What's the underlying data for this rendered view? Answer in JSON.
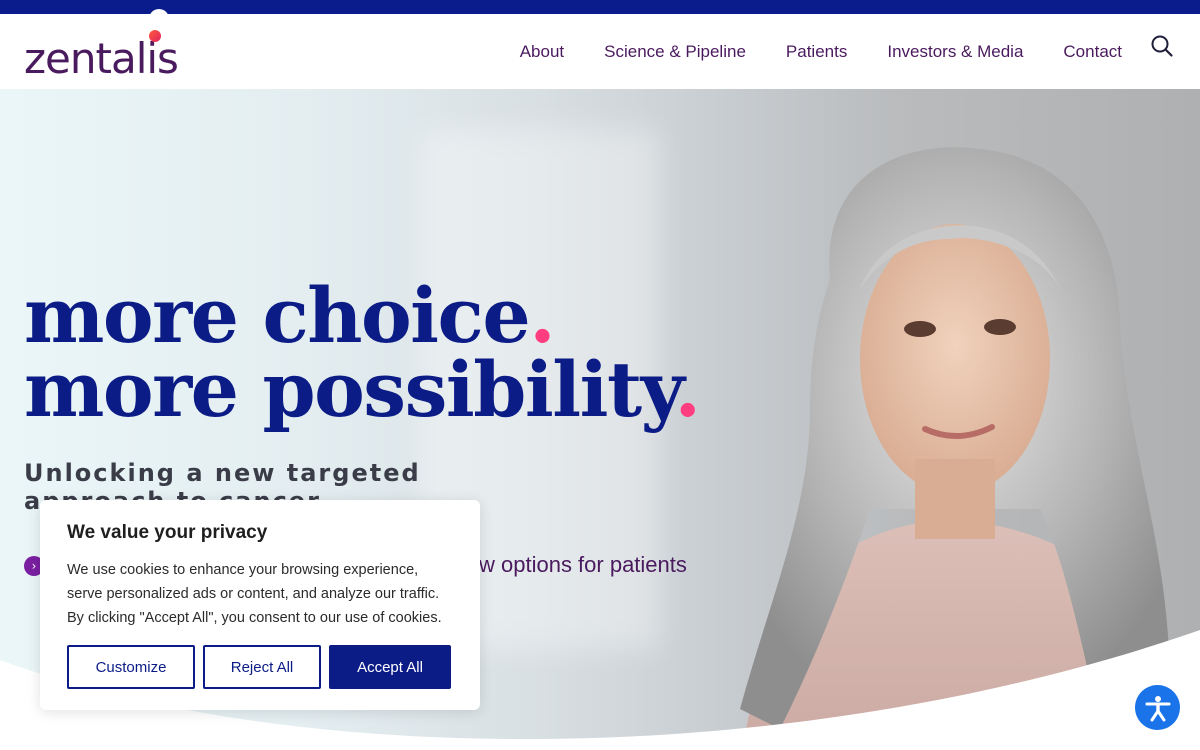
{
  "brand": {
    "logo_text": "zentalis"
  },
  "nav": {
    "items": [
      "About",
      "Science & Pipeline",
      "Patients",
      "Investors & Media",
      "Contact"
    ],
    "search_icon": "search-icon"
  },
  "hero": {
    "headline_line1": "more choice",
    "headline_line2": "more possibility",
    "headline_dot": ".",
    "subhead": "Unlocking a new targeted approach to cancer",
    "cta_text": "w options for patients"
  },
  "cookie_banner": {
    "title": "We value your privacy",
    "body": "We use cookies to enhance your browsing experience, serve personalized ads or content, and analyze our traffic. By clicking \"Accept All\", you consent to our use of cookies.",
    "customize_label": "Customize",
    "reject_label": "Reject All",
    "accept_label": "Accept All"
  },
  "accessibility_widget": {
    "icon": "accessibility-icon"
  },
  "colors": {
    "brand_navy": "#0c1c86",
    "brand_purple": "#4a1a5e",
    "accent_pink": "#ff3d7f",
    "a11y_blue": "#1a73e8"
  }
}
